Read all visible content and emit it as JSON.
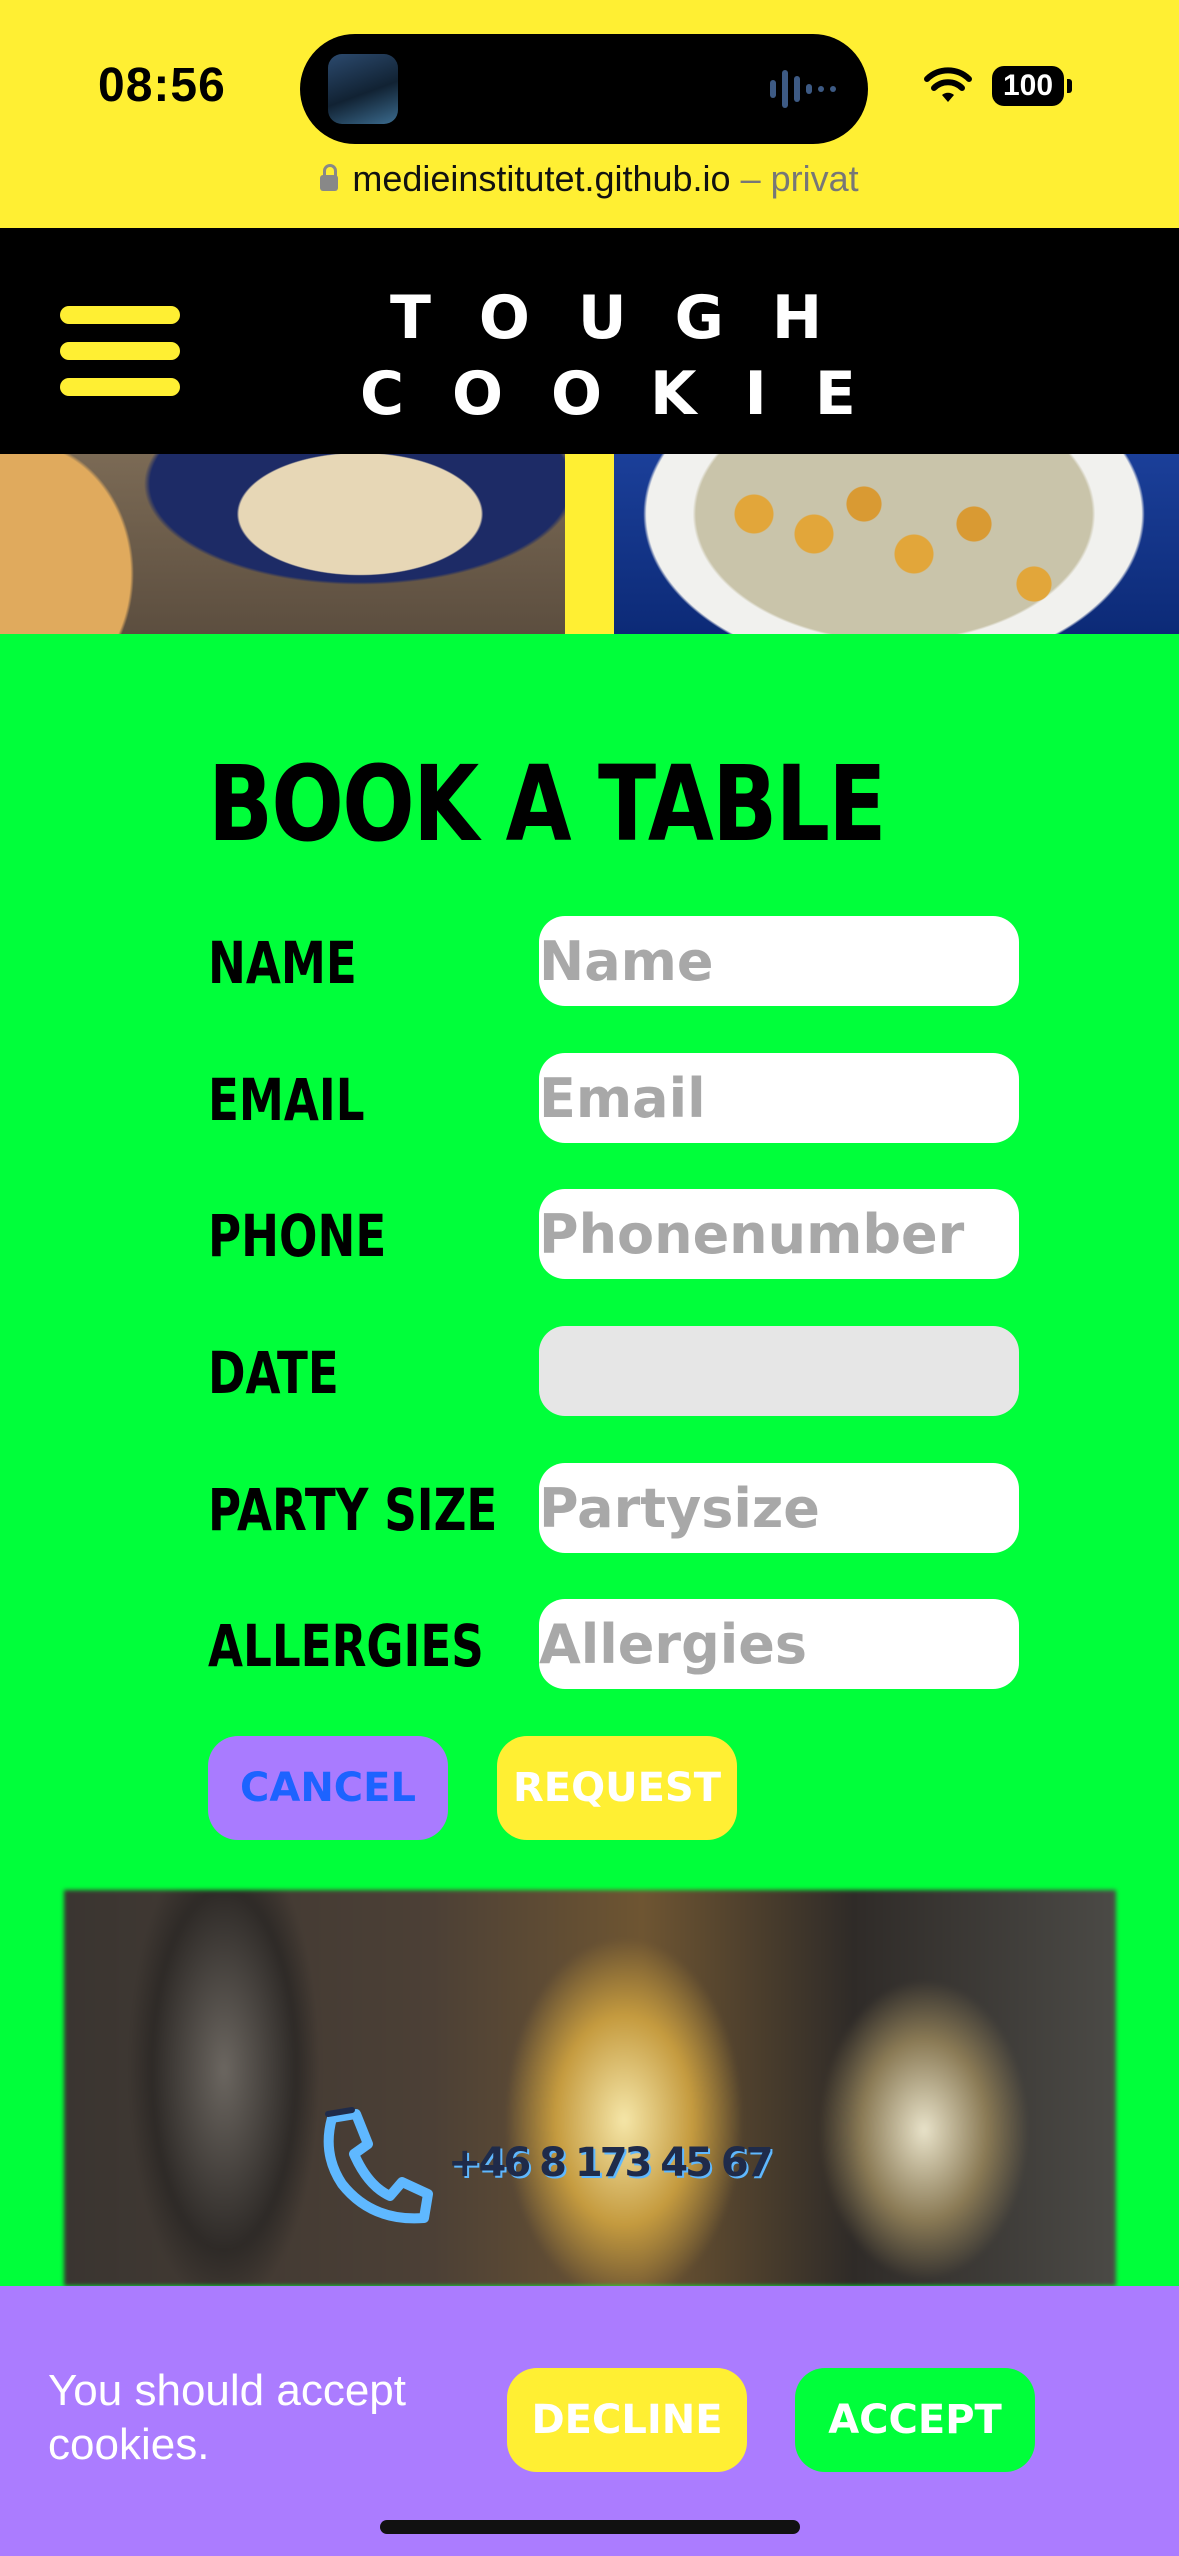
{
  "status_bar": {
    "time": "08:56",
    "battery": "100",
    "url": "medieinstitutet.github.io",
    "url_suffix": " – privat"
  },
  "header": {
    "logo_line1": "TOUGH",
    "logo_line2": "COOKIE",
    "menu_icon": "hamburger-icon"
  },
  "booking": {
    "title": "BOOK A TABLE",
    "fields": [
      {
        "label": "NAME",
        "placeholder": "Name"
      },
      {
        "label": "EMAIL",
        "placeholder": "Email"
      },
      {
        "label": "PHONE",
        "placeholder": "Phonenumber"
      },
      {
        "label": "DATE",
        "placeholder": ""
      },
      {
        "label": "PARTY SIZE",
        "placeholder": "Partysize"
      },
      {
        "label": "ALLERGIES",
        "placeholder": "Allergies"
      }
    ],
    "cancel_label": "CANCEL",
    "request_label": "REQUEST"
  },
  "contact": {
    "icon": "phone-icon",
    "phone": "+46 8 173 45 67"
  },
  "cookie_banner": {
    "text": "You should accept cookies.",
    "decline_label": "DECLINE",
    "accept_label": "ACCEPT"
  },
  "colors": {
    "yellow": "#ffef33",
    "green": "#00ff3a",
    "purple": "#ab7cff",
    "black": "#000000",
    "blue_text": "#1d63ff"
  }
}
